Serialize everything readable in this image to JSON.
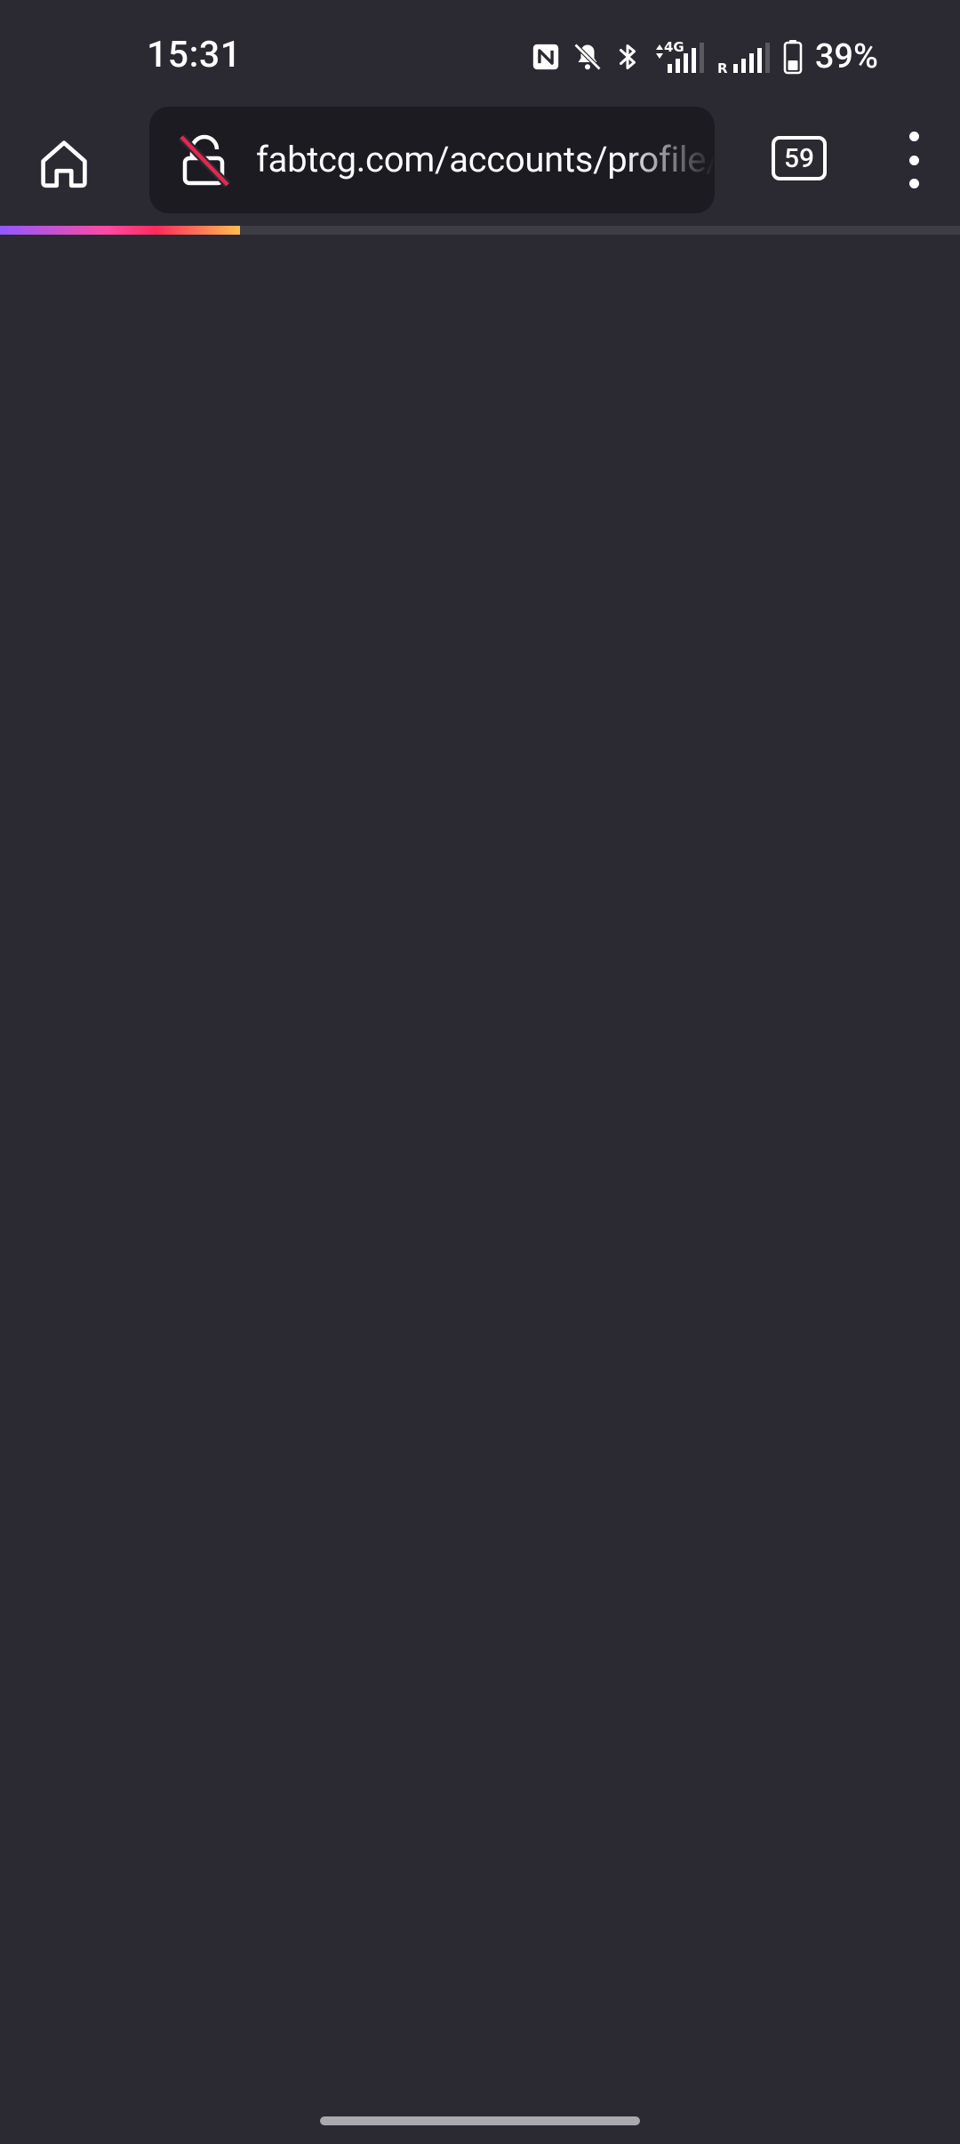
{
  "status_bar": {
    "time": "15:31",
    "icons": [
      "nfc-icon",
      "bell-muted-icon",
      "bluetooth-icon",
      "mobile-data-4g-icon",
      "signal-roaming-icon",
      "battery-icon"
    ],
    "data_type": "4G",
    "roaming_marker": "R",
    "battery_percent": "39%"
  },
  "toolbar": {
    "url": "fabtcg.com/accounts/profile/r",
    "tab_count": "59",
    "icons": [
      "home-icon",
      "insecure-lock-icon",
      "tabs-counter-icon",
      "more-vert-icon"
    ]
  },
  "page_load": {
    "progress": 0.25,
    "colors": [
      "#9059ff",
      "#ff4aa2",
      "#ff2a5d",
      "#ffbd4f"
    ]
  },
  "theme": {
    "background": "#2b2a33",
    "url_bar_background": "#1c1b22",
    "insecure_accent": "#e22850",
    "text": "#fbfbfe"
  }
}
